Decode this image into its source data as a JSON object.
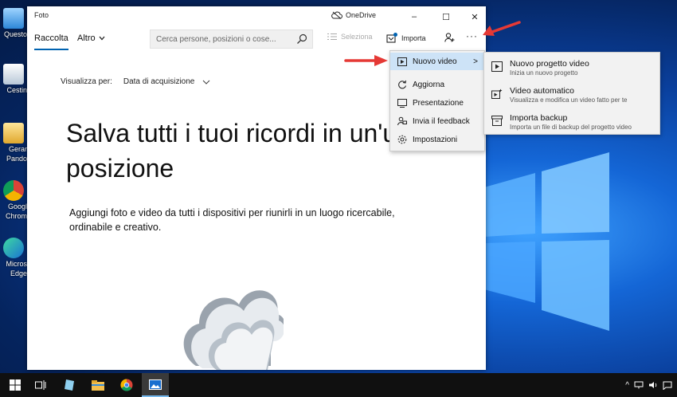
{
  "window": {
    "title": "Foto",
    "onedrive_label": "OneDrive",
    "controls": {
      "minimize": "–",
      "maximize": "☐",
      "close": "✕"
    }
  },
  "toolbar": {
    "tabs": [
      {
        "label": "Raccolta",
        "active": true
      },
      {
        "label": "Altro"
      }
    ],
    "search_placeholder": "Cerca persone, posizioni o cose...",
    "select_label": "Seleziona",
    "import_label": "Importa",
    "more_label": "···"
  },
  "main": {
    "view_by_label": "Visualizza per:",
    "view_by_value": "Data di acquisizione",
    "headline_line1": "Salva tutti i tuoi ricordi in un'u",
    "headline_line2": "posizione",
    "subtext_line1": "Aggiungi foto e video da tutti i dispositivi per riunirli in un luogo ricercabile,",
    "subtext_line2": "ordinabile e creativo."
  },
  "menu": {
    "items": [
      {
        "label": "Nuovo video",
        "icon": "video-icon",
        "highlighted": true,
        "submenu": true
      },
      {
        "label": "Aggiorna",
        "icon": "refresh-icon"
      },
      {
        "label": "Presentazione",
        "icon": "slideshow-icon"
      },
      {
        "label": "Invia il feedback",
        "icon": "feedback-icon"
      },
      {
        "label": "Impostazioni",
        "icon": "settings-icon"
      }
    ]
  },
  "submenu": {
    "items": [
      {
        "title": "Nuovo progetto video",
        "desc": "Inizia un nuovo progetto",
        "icon": "video-project-icon"
      },
      {
        "title": "Video automatico",
        "desc": "Visualizza e modifica un video fatto per te",
        "icon": "auto-video-icon"
      },
      {
        "title": "Importa backup",
        "desc": "Importa un file di backup del progetto video",
        "icon": "archive-icon"
      }
    ]
  },
  "desktop_icons": [
    {
      "label": "Questo",
      "icon": "computer-icon"
    },
    {
      "label": "Cestin",
      "icon": "recycle-bin-icon"
    },
    {
      "label": "Gerar",
      "icon": "user-folder-icon"
    },
    {
      "label": "Pando",
      "icon": ""
    },
    {
      "label": "Googl",
      "icon": "chrome-icon"
    },
    {
      "label": "Chrom",
      "icon": ""
    },
    {
      "label": "Micros",
      "icon": "edge-icon"
    },
    {
      "label": "Edge",
      "icon": ""
    }
  ],
  "taskbar": {
    "apps": [
      "windows-start-icon",
      "task-view-icon",
      "notepad-icon",
      "file-explorer-icon",
      "chrome-icon",
      "photos-icon"
    ]
  },
  "colors": {
    "accent": "#0063b1",
    "highlight": "#cde3f7",
    "arrow": "#e53935"
  }
}
